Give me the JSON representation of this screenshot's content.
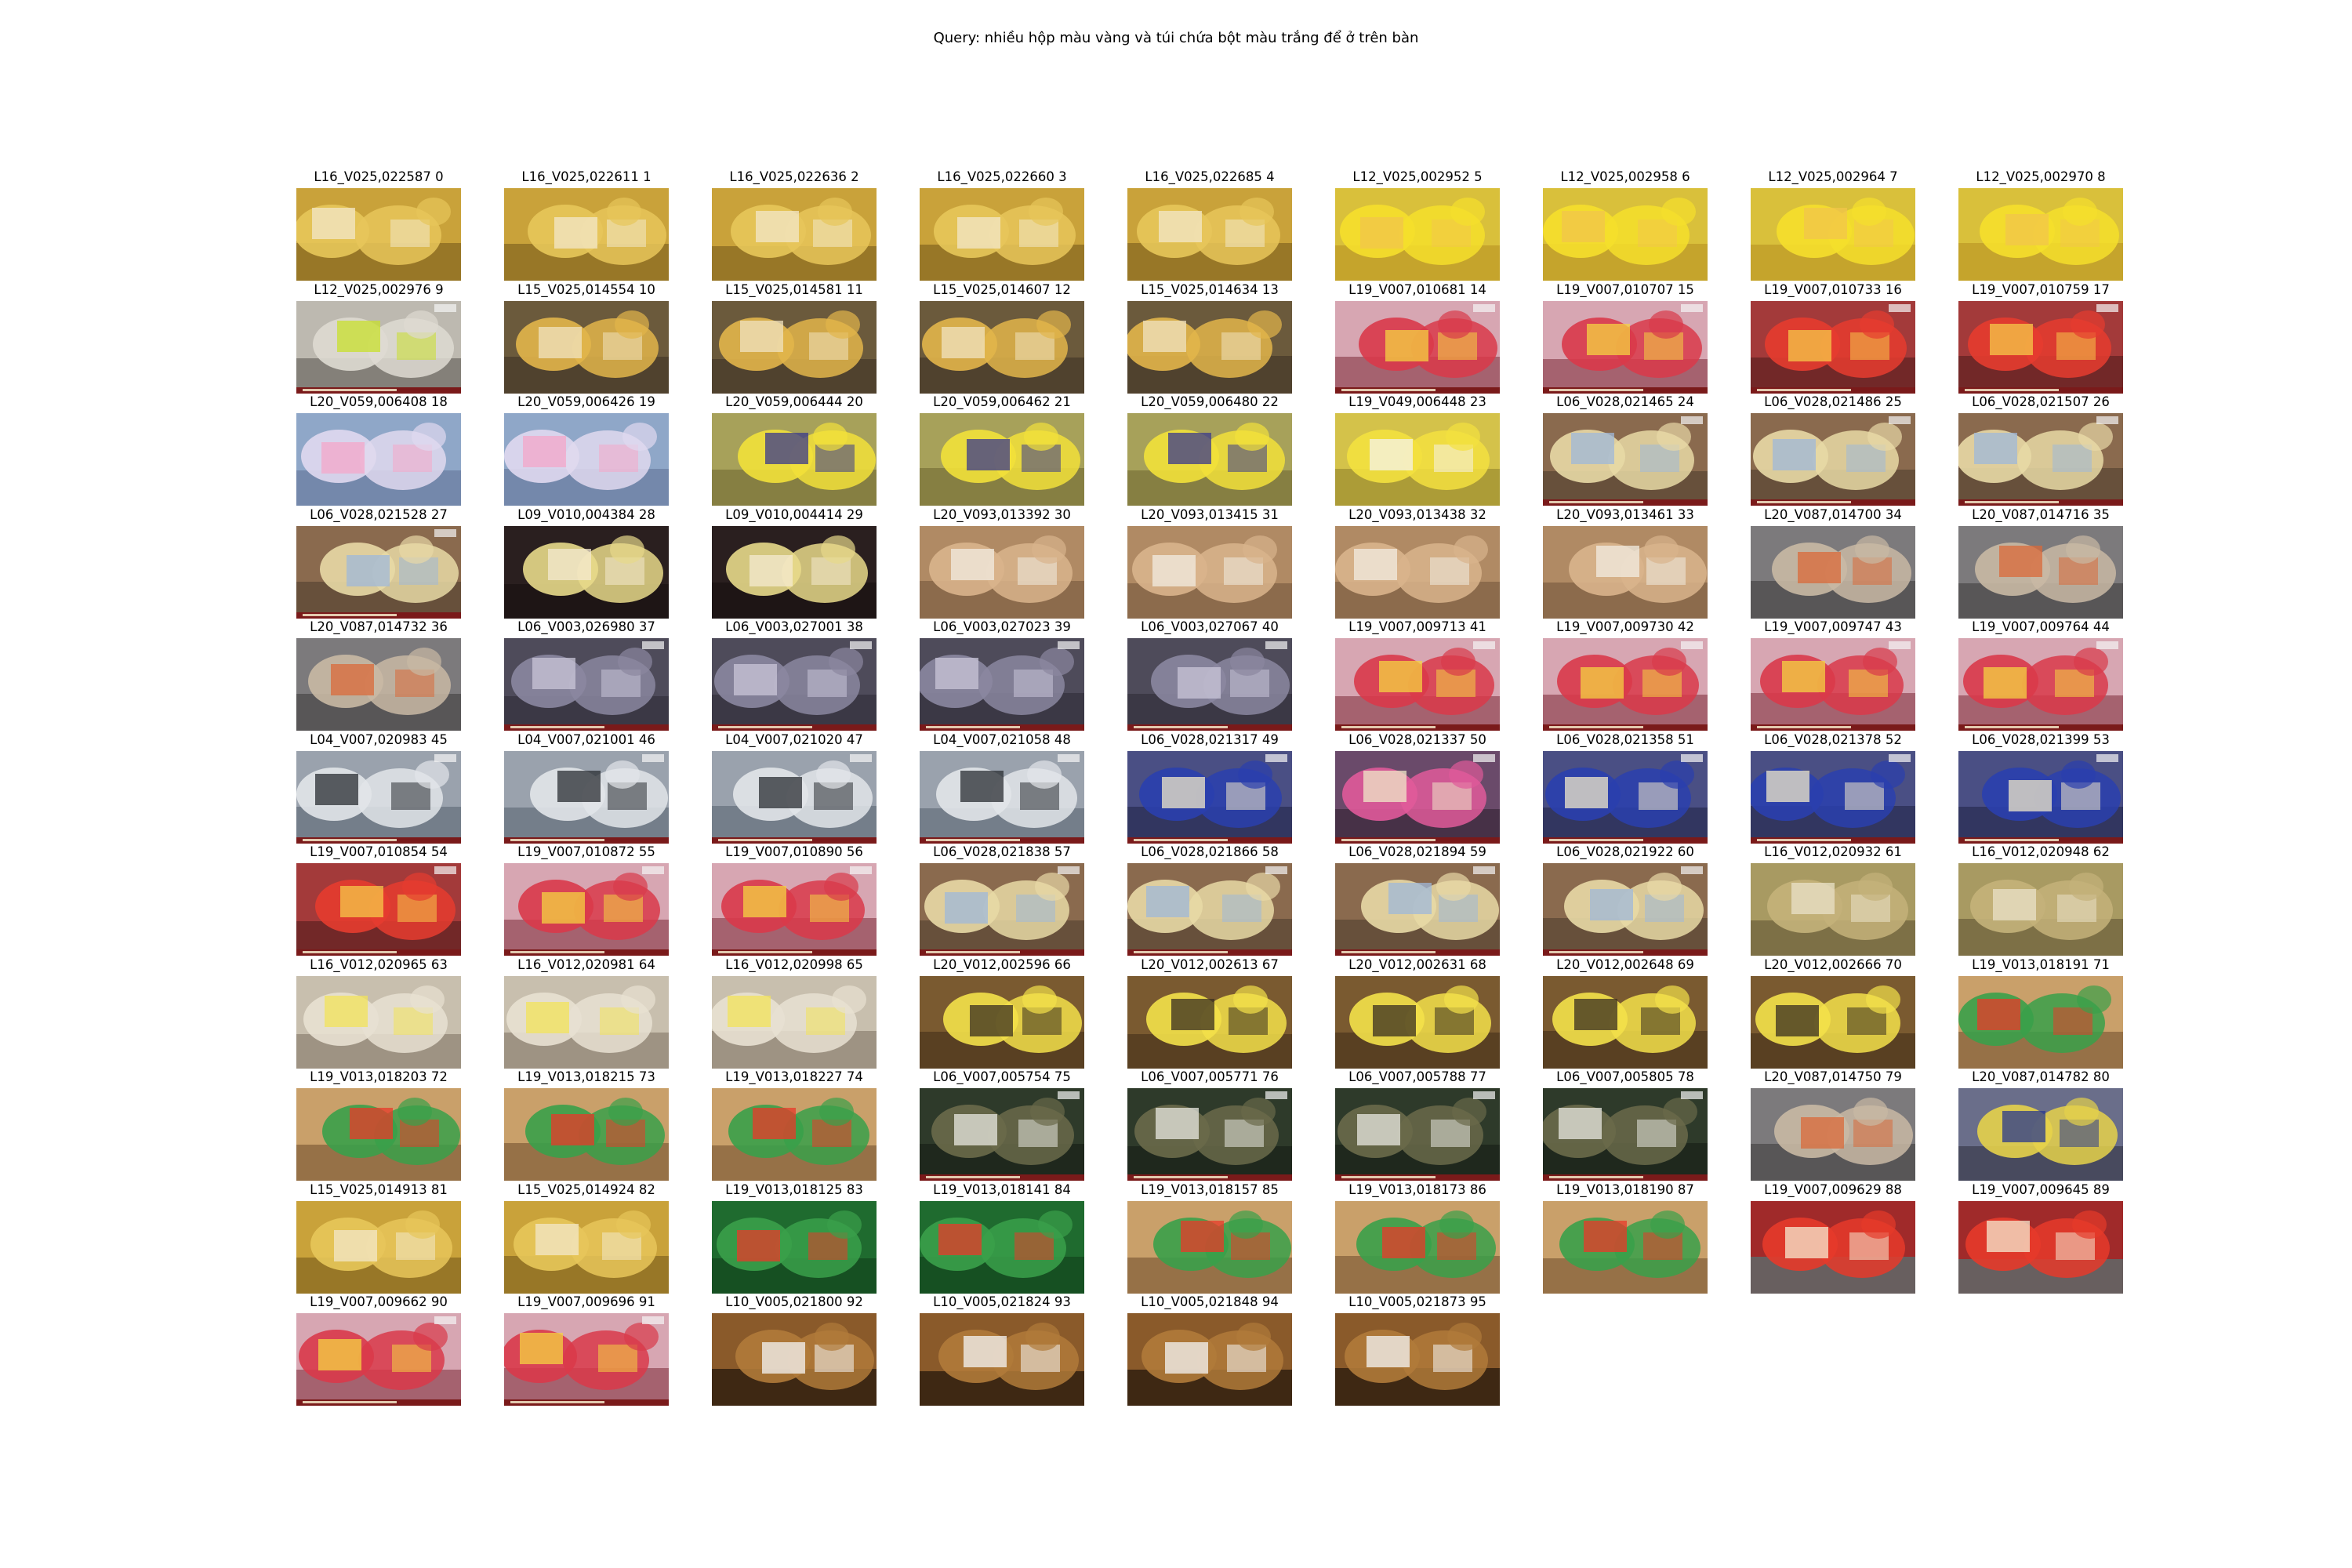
{
  "query": "Query: nhiều hộp màu vàng và túi chứa bột màu trắng để ở trên bàn",
  "themes": {
    "yellow_bag": {
      "bg": "#c9a23a",
      "mid": "#e7c65a",
      "acc": "#f3e7c9",
      "dark": "#6f5418",
      "bar": ""
    },
    "yellow_box": {
      "bg": "#d9c03b",
      "mid": "#f5df2c",
      "acc": "#f2c64b",
      "dark": "#b48d21",
      "bar": ""
    },
    "worker": {
      "bg": "#bdb9b0",
      "mid": "#dedad2",
      "acc": "#c8e02c",
      "dark": "#55524c",
      "bar": "#7a1a1a"
    },
    "pack_table": {
      "bg": "#6b5a3c",
      "mid": "#e2b54a",
      "acc": "#f0e3c0",
      "dark": "#3a3022",
      "bar": ""
    },
    "gift_baskets": {
      "bg": "#d7a6b2",
      "mid": "#d93a4a",
      "acc": "#f4d341",
      "dark": "#7b2a38",
      "bar": "#7a1a1a"
    },
    "gift_boxes": {
      "bg": "#a33a3a",
      "mid": "#e63c2f",
      "acc": "#f5c94a",
      "dark": "#4a1a1a",
      "bar": "#7a1a1a"
    },
    "books": {
      "bg": "#8fa7c8",
      "mid": "#e0d9ef",
      "acc": "#f4a7c9",
      "dark": "#5e6f93",
      "bar": ""
    },
    "yellow_packs": {
      "bg": "#a7a15a",
      "mid": "#f2e13a",
      "acc": "#3a3a8c",
      "dark": "#6b6530",
      "bar": ""
    },
    "eggs": {
      "bg": "#d4c24a",
      "mid": "#f3e13f",
      "acc": "#f5f3ea",
      "dark": "#8b7e28",
      "bar": ""
    },
    "evidence": {
      "bg": "#8a6a4e",
      "mid": "#e8d9a6",
      "acc": "#9fb8d9",
      "dark": "#4b3a2c",
      "bar": "#7a1a1a"
    },
    "dark_packs": {
      "bg": "#2a1f1f",
      "mid": "#e7d98a",
      "acc": "#f4ead0",
      "dark": "#140d0d",
      "bar": ""
    },
    "cartons": {
      "bg": "#b08a64",
      "mid": "#d9b48c",
      "acc": "#f1ece2",
      "dark": "#6f5238",
      "bar": ""
    },
    "hanging_bags": {
      "bg": "#7c7a7c",
      "mid": "#c9b9a4",
      "acc": "#d96a3a",
      "dark": "#3a3838",
      "bar": ""
    },
    "warehouse": {
      "bg": "#4e4b5a",
      "mid": "#8b87a0",
      "acc": "#c9c5d8",
      "dark": "#2c2a34",
      "bar": "#7a1a1a"
    },
    "boxes_bags": {
      "bg": "#9aa2ad",
      "mid": "#e2e5e9",
      "acc": "#2a2d33",
      "dark": "#55606e",
      "bar": "#7a1a1a"
    },
    "blue_packs": {
      "bg": "#4a4f84",
      "mid": "#2a3fae",
      "acc": "#f0e8c8",
      "dark": "#1f2244",
      "bar": "#7a1a1a"
    },
    "pink_packs": {
      "bg": "#6a4a6a",
      "mid": "#e05a9a",
      "acc": "#f0e8c8",
      "dark": "#2a1d2a",
      "bar": "#7a1a1a"
    },
    "door": {
      "bg": "#a89a62",
      "mid": "#c4b27a",
      "acc": "#e9e2c8",
      "dark": "#5a4f30",
      "bar": ""
    },
    "open_box": {
      "bg": "#c8bfae",
      "mid": "#e8e1d2",
      "acc": "#f2e35a",
      "dark": "#7b7060",
      "bar": ""
    },
    "yellow_sacks": {
      "bg": "#7a5a30",
      "mid": "#f3e14a",
      "acc": "#3a2f20",
      "dark": "#3e2c18",
      "bar": ""
    },
    "milo_boxes": {
      "bg": "#c9a06a",
      "mid": "#3aa04a",
      "acc": "#e83a2a",
      "dark": "#6b4a2a",
      "bar": ""
    },
    "milo_packs": {
      "bg": "#1f6b2f",
      "mid": "#3aa04a",
      "acc": "#e83a2a",
      "dark": "#0f3a18",
      "bar": ""
    },
    "kitchen": {
      "bg": "#2e3a2a",
      "mid": "#6a6a4a",
      "acc": "#e8e8e0",
      "dark": "#141a12",
      "bar": "#7a1a1a"
    },
    "blanket_bags": {
      "bg": "#6a6e8a",
      "mid": "#e6d24a",
      "acc": "#2a3a8c",
      "dark": "#2c2e3a",
      "bar": ""
    },
    "red_cans": {
      "bg": "#a02a2a",
      "mid": "#e63a2a",
      "acc": "#f5e9d0",
      "dark": "#3a8a8a",
      "bar": ""
    },
    "wood_tray": {
      "bg": "#8a5a2a",
      "mid": "#b07a3a",
      "acc": "#f5f5f5",
      "dark": "#000000",
      "bar": ""
    }
  },
  "tiles": [
    {
      "label": "L16_V025,022587 0",
      "theme": "yellow_bag"
    },
    {
      "label": "L16_V025,022611 1",
      "theme": "yellow_bag"
    },
    {
      "label": "L16_V025,022636 2",
      "theme": "yellow_bag"
    },
    {
      "label": "L16_V025,022660 3",
      "theme": "yellow_bag"
    },
    {
      "label": "L16_V025,022685 4",
      "theme": "yellow_bag"
    },
    {
      "label": "L12_V025,002952 5",
      "theme": "yellow_box"
    },
    {
      "label": "L12_V025,002958 6",
      "theme": "yellow_box"
    },
    {
      "label": "L12_V025,002964 7",
      "theme": "yellow_box"
    },
    {
      "label": "L12_V025,002970 8",
      "theme": "yellow_box"
    },
    {
      "label": "L12_V025,002976 9",
      "theme": "worker"
    },
    {
      "label": "L15_V025,014554 10",
      "theme": "pack_table"
    },
    {
      "label": "L15_V025,014581 11",
      "theme": "pack_table"
    },
    {
      "label": "L15_V025,014607 12",
      "theme": "pack_table"
    },
    {
      "label": "L15_V025,014634 13",
      "theme": "pack_table"
    },
    {
      "label": "L19_V007,010681 14",
      "theme": "gift_baskets"
    },
    {
      "label": "L19_V007,010707 15",
      "theme": "gift_baskets"
    },
    {
      "label": "L19_V007,010733 16",
      "theme": "gift_boxes"
    },
    {
      "label": "L19_V007,010759 17",
      "theme": "gift_boxes"
    },
    {
      "label": "L20_V059,006408 18",
      "theme": "books"
    },
    {
      "label": "L20_V059,006426 19",
      "theme": "books"
    },
    {
      "label": "L20_V059,006444 20",
      "theme": "yellow_packs"
    },
    {
      "label": "L20_V059,006462 21",
      "theme": "yellow_packs"
    },
    {
      "label": "L20_V059,006480 22",
      "theme": "yellow_packs"
    },
    {
      "label": "L19_V049,006448 23",
      "theme": "eggs"
    },
    {
      "label": "L06_V028,021465 24",
      "theme": "evidence"
    },
    {
      "label": "L06_V028,021486 25",
      "theme": "evidence"
    },
    {
      "label": "L06_V028,021507 26",
      "theme": "evidence"
    },
    {
      "label": "L06_V028,021528 27",
      "theme": "evidence"
    },
    {
      "label": "L09_V010,004384 28",
      "theme": "dark_packs"
    },
    {
      "label": "L09_V010,004414 29",
      "theme": "dark_packs"
    },
    {
      "label": "L20_V093,013392 30",
      "theme": "cartons"
    },
    {
      "label": "L20_V093,013415 31",
      "theme": "cartons"
    },
    {
      "label": "L20_V093,013438 32",
      "theme": "cartons"
    },
    {
      "label": "L20_V093,013461 33",
      "theme": "cartons"
    },
    {
      "label": "L20_V087,014700 34",
      "theme": "hanging_bags"
    },
    {
      "label": "L20_V087,014716 35",
      "theme": "hanging_bags"
    },
    {
      "label": "L20_V087,014732 36",
      "theme": "hanging_bags"
    },
    {
      "label": "L06_V003,026980 37",
      "theme": "warehouse"
    },
    {
      "label": "L06_V003,027001 38",
      "theme": "warehouse"
    },
    {
      "label": "L06_V003,027023 39",
      "theme": "warehouse"
    },
    {
      "label": "L06_V003,027067 40",
      "theme": "warehouse"
    },
    {
      "label": "L19_V007,009713 41",
      "theme": "gift_baskets"
    },
    {
      "label": "L19_V007,009730 42",
      "theme": "gift_baskets"
    },
    {
      "label": "L19_V007,009747 43",
      "theme": "gift_baskets"
    },
    {
      "label": "L19_V007,009764 44",
      "theme": "gift_baskets"
    },
    {
      "label": "L04_V007,020983 45",
      "theme": "boxes_bags"
    },
    {
      "label": "L04_V007,021001 46",
      "theme": "boxes_bags"
    },
    {
      "label": "L04_V007,021020 47",
      "theme": "boxes_bags"
    },
    {
      "label": "L04_V007,021058 48",
      "theme": "boxes_bags"
    },
    {
      "label": "L06_V028,021317 49",
      "theme": "blue_packs"
    },
    {
      "label": "L06_V028,021337 50",
      "theme": "pink_packs"
    },
    {
      "label": "L06_V028,021358 51",
      "theme": "blue_packs"
    },
    {
      "label": "L06_V028,021378 52",
      "theme": "blue_packs"
    },
    {
      "label": "L06_V028,021399 53",
      "theme": "blue_packs"
    },
    {
      "label": "L19_V007,010854 54",
      "theme": "gift_boxes"
    },
    {
      "label": "L19_V007,010872 55",
      "theme": "gift_baskets"
    },
    {
      "label": "L19_V007,010890 56",
      "theme": "gift_baskets"
    },
    {
      "label": "L06_V028,021838 57",
      "theme": "evidence"
    },
    {
      "label": "L06_V028,021866 58",
      "theme": "evidence"
    },
    {
      "label": "L06_V028,021894 59",
      "theme": "evidence"
    },
    {
      "label": "L06_V028,021922 60",
      "theme": "evidence"
    },
    {
      "label": "L16_V012,020932 61",
      "theme": "door"
    },
    {
      "label": "L16_V012,020948 62",
      "theme": "door"
    },
    {
      "label": "L16_V012,020965 63",
      "theme": "open_box"
    },
    {
      "label": "L16_V012,020981 64",
      "theme": "open_box"
    },
    {
      "label": "L16_V012,020998 65",
      "theme": "open_box"
    },
    {
      "label": "L20_V012,002596 66",
      "theme": "yellow_sacks"
    },
    {
      "label": "L20_V012,002613 67",
      "theme": "yellow_sacks"
    },
    {
      "label": "L20_V012,002631 68",
      "theme": "yellow_sacks"
    },
    {
      "label": "L20_V012,002648 69",
      "theme": "yellow_sacks"
    },
    {
      "label": "L20_V012,002666 70",
      "theme": "yellow_sacks"
    },
    {
      "label": "L19_V013,018191 71",
      "theme": "milo_boxes"
    },
    {
      "label": "L19_V013,018203 72",
      "theme": "milo_boxes"
    },
    {
      "label": "L19_V013,018215 73",
      "theme": "milo_boxes"
    },
    {
      "label": "L19_V013,018227 74",
      "theme": "milo_boxes"
    },
    {
      "label": "L06_V007,005754 75",
      "theme": "kitchen"
    },
    {
      "label": "L06_V007,005771 76",
      "theme": "kitchen"
    },
    {
      "label": "L06_V007,005788 77",
      "theme": "kitchen"
    },
    {
      "label": "L06_V007,005805 78",
      "theme": "kitchen"
    },
    {
      "label": "L20_V087,014750 79",
      "theme": "hanging_bags"
    },
    {
      "label": "L20_V087,014782 80",
      "theme": "blanket_bags"
    },
    {
      "label": "L15_V025,014913 81",
      "theme": "yellow_bag"
    },
    {
      "label": "L15_V025,014924 82",
      "theme": "yellow_bag"
    },
    {
      "label": "L19_V013,018125 83",
      "theme": "milo_packs"
    },
    {
      "label": "L19_V013,018141 84",
      "theme": "milo_packs"
    },
    {
      "label": "L19_V013,018157 85",
      "theme": "milo_boxes"
    },
    {
      "label": "L19_V013,018173 86",
      "theme": "milo_boxes"
    },
    {
      "label": "L19_V013,018190 87",
      "theme": "milo_boxes"
    },
    {
      "label": "L19_V007,009629 88",
      "theme": "red_cans"
    },
    {
      "label": "L19_V007,009645 89",
      "theme": "red_cans"
    },
    {
      "label": "L19_V007,009662 90",
      "theme": "gift_baskets"
    },
    {
      "label": "L19_V007,009696 91",
      "theme": "gift_baskets"
    },
    {
      "label": "L10_V005,021800 92",
      "theme": "wood_tray"
    },
    {
      "label": "L10_V005,021824 93",
      "theme": "wood_tray"
    },
    {
      "label": "L10_V005,021848 94",
      "theme": "wood_tray"
    },
    {
      "label": "L10_V005,021873 95",
      "theme": "wood_tray"
    }
  ]
}
